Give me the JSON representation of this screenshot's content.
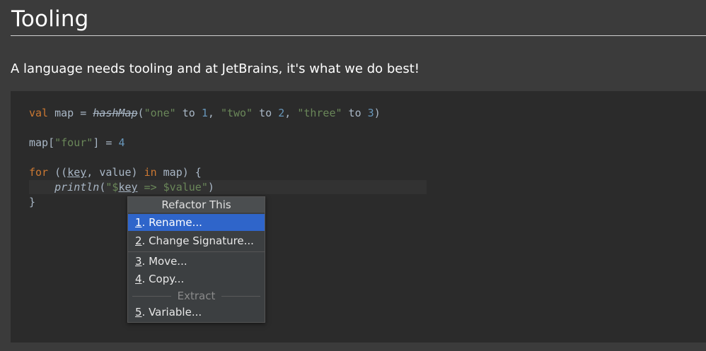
{
  "page": {
    "title": "Tooling",
    "intro": "A language needs tooling and at JetBrains, it's what we do best!"
  },
  "code": {
    "line1": {
      "val_kw": "val",
      "text_a": " map = ",
      "fn": "hashMap",
      "text_b": "(",
      "s1": "\"one\"",
      "to1": " to ",
      "n1": "1",
      "c1": ", ",
      "s2": "\"two\"",
      "to2": " to ",
      "n2": "2",
      "c2": ", ",
      "s3": "\"three\"",
      "to3": " to ",
      "n3": "3",
      "end": ")"
    },
    "line2": {
      "a": "map[",
      "s": "\"four\"",
      "b": "] = ",
      "n": "4"
    },
    "line3": {
      "for_kw": "for",
      "a": " ((",
      "key": "key",
      "b": ", value) ",
      "in_kw": "in",
      "c": " map) {"
    },
    "line4": {
      "indent": "    ",
      "fn": "println",
      "a": "(",
      "s1": "\"$",
      "key": "key",
      "s2": " => ",
      "s3": "$value\"",
      "end": ")"
    },
    "line5": "}"
  },
  "menu": {
    "header": "Refactor This",
    "items": [
      {
        "num": "1",
        "label": ". Rename..."
      },
      {
        "num": "2",
        "label": ". Change Signature..."
      },
      {
        "num": "3",
        "label": ". Move..."
      },
      {
        "num": "4",
        "label": ". Copy..."
      },
      {
        "num": "5",
        "label": ". Variable..."
      }
    ],
    "group_label": "Extract"
  },
  "colors": {
    "background": "#3b3b3b",
    "code_background": "#2b2b2b",
    "keyword": "#cc7832",
    "string": "#6a8759",
    "number": "#6897bb",
    "selection": "#2f65ca"
  }
}
